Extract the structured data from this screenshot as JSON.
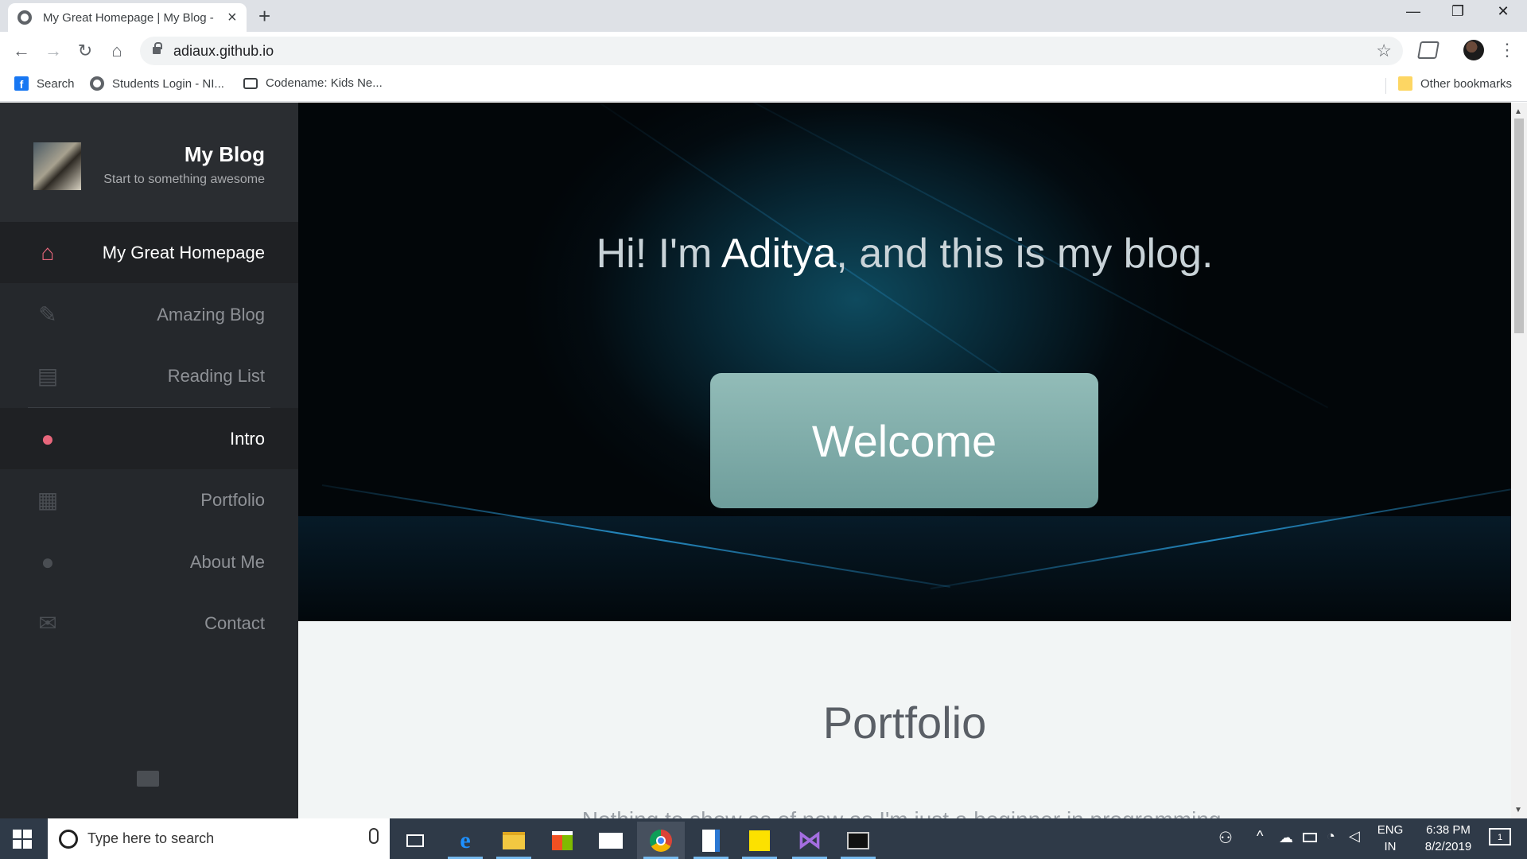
{
  "browser": {
    "tab_title": "My Great Homepage | My Blog - ",
    "url": "adiaux.github.io",
    "bookmarks": [
      {
        "label": "Search",
        "icon": "facebook-icon"
      },
      {
        "label": "Students Login - NI...",
        "icon": "globe-icon"
      },
      {
        "label": "Codename: Kids Ne...",
        "icon": "briefcase-icon"
      }
    ],
    "other_bookmarks": "Other bookmarks"
  },
  "sidebar": {
    "brand_title": "My Blog",
    "brand_subtitle": "Start to something awesome",
    "items": [
      {
        "label": "My Great Homepage",
        "icon": "home-icon",
        "active": true
      },
      {
        "label": "Amazing Blog",
        "icon": "pencil-icon",
        "active": false
      },
      {
        "label": "Reading List",
        "icon": "book-icon",
        "active": false
      },
      {
        "label": "Intro",
        "icon": "speech-bubble-icon",
        "active": true
      },
      {
        "label": "Portfolio",
        "icon": "grid-icon",
        "active": false
      },
      {
        "label": "About Me",
        "icon": "user-icon",
        "active": false
      },
      {
        "label": "Contact",
        "icon": "envelope-icon",
        "active": false
      }
    ],
    "footer_icon": "envelope-icon"
  },
  "hero": {
    "greeting_pre": "Hi! I'm ",
    "name": "Aditya",
    "greeting_post": ", and this is my blog.",
    "button_label": "Welcome"
  },
  "portfolio": {
    "title": "Portfolio",
    "text": "Nothing to show as of now as I'm just a beginner in programming."
  },
  "taskbar": {
    "search_placeholder": "Type here to search",
    "language": "ENG",
    "region": "IN",
    "time": "6:38 PM",
    "date": "8/2/2019",
    "notification_count": "1"
  },
  "colors": {
    "sidebar_bg": "#25282c",
    "active_icon": "#e8677c",
    "welcome_button": "#7fadab",
    "taskbar_bg": "#2f3a48"
  }
}
